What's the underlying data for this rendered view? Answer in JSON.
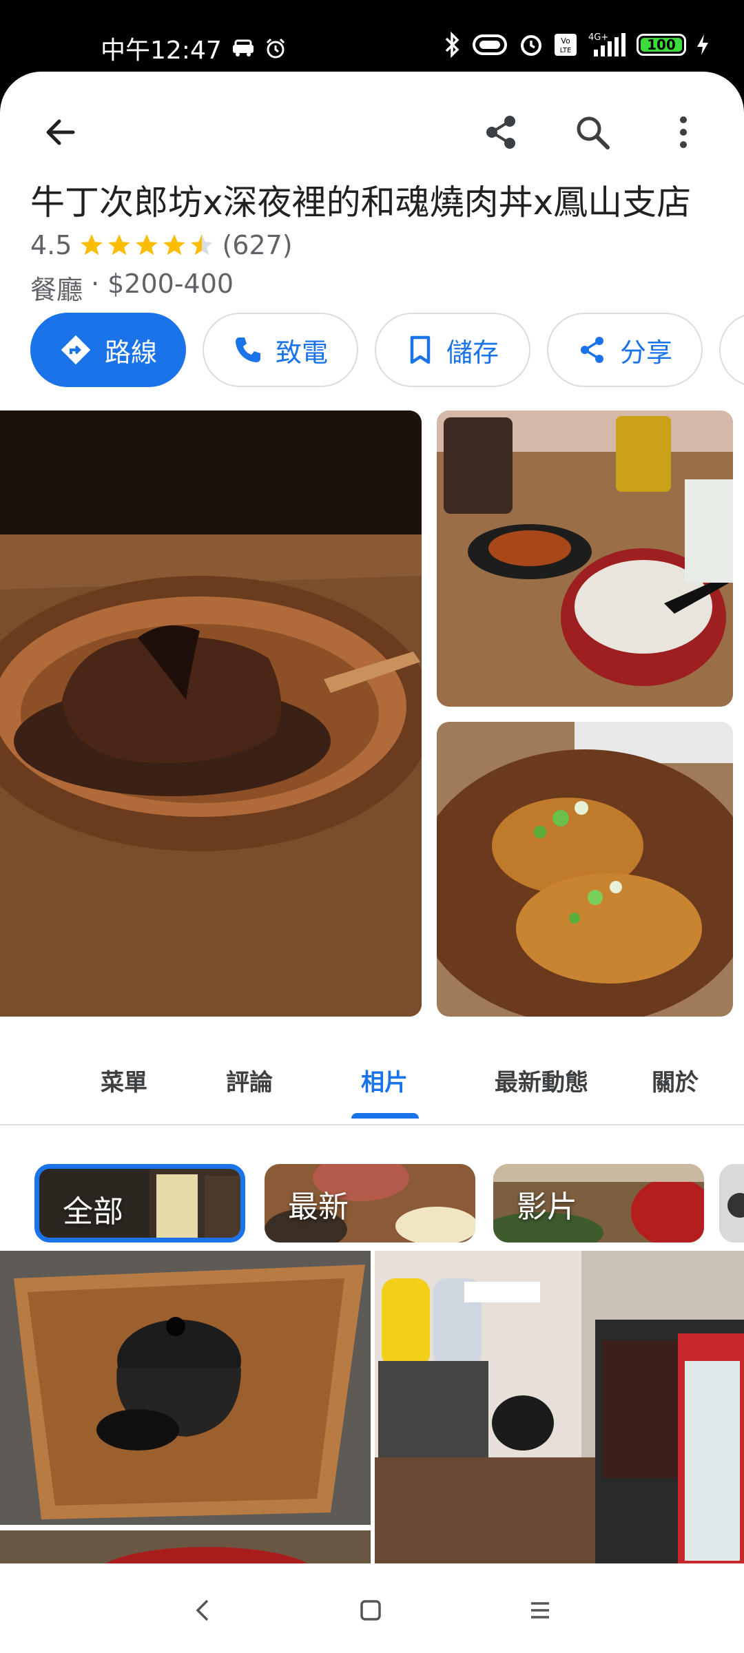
{
  "status_bar": {
    "time": "中午12:47",
    "network": "4G+",
    "volte": "Vo LTE",
    "battery": "100"
  },
  "place": {
    "title": "牛丁次郎坊x深夜裡的和魂燒肉丼x鳳山支店",
    "rating": "4.5",
    "reviews": "(627)",
    "category": "餐廳",
    "separator": "·",
    "price": "$200-400"
  },
  "actions": [
    {
      "label": "路線",
      "icon": "directions-icon"
    },
    {
      "label": "致電",
      "icon": "phone-icon"
    },
    {
      "label": "儲存",
      "icon": "bookmark-icon"
    },
    {
      "label": "分享",
      "icon": "share-icon"
    }
  ],
  "tabs": [
    {
      "label": "菜單"
    },
    {
      "label": "評論"
    },
    {
      "label": "相片"
    },
    {
      "label": "最新動態"
    },
    {
      "label": "關於"
    }
  ],
  "photo_filters": [
    {
      "label": "全部"
    },
    {
      "label": "最新"
    },
    {
      "label": "影片"
    }
  ],
  "colors": {
    "accent": "#1a73e8",
    "star": "#fbbc04",
    "text_primary": "#202124",
    "text_secondary": "#5f6368"
  }
}
